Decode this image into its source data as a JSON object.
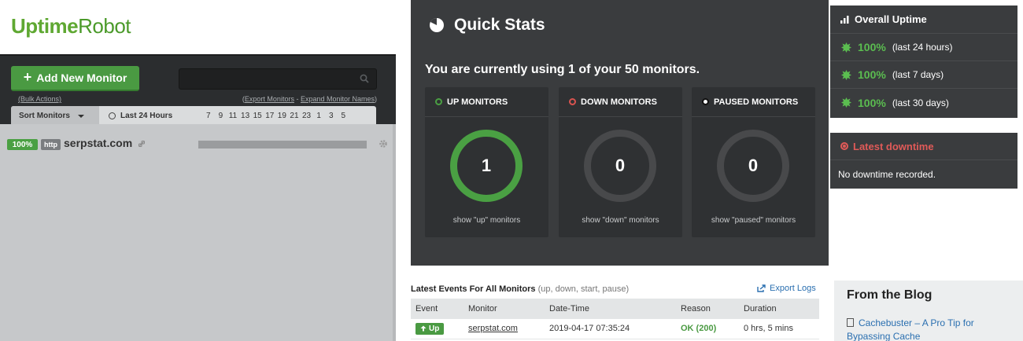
{
  "app": {
    "logo_part1": "Uptime",
    "logo_part2": "Robot"
  },
  "left": {
    "add_monitor_label": "Add New Monitor",
    "bulk_actions": "(Bulk Actions)",
    "export_monitors": "Export Monitors",
    "separator": " - ",
    "expand_names": "Expand Monitor Names",
    "search_placeholder": "",
    "sort_label": "Sort Monitors",
    "last24_label": "Last 24 Hours",
    "hours": [
      "7",
      "9",
      "11",
      "13",
      "15",
      "17",
      "19",
      "21",
      "23",
      "1",
      "3",
      "5"
    ],
    "monitors": [
      {
        "uptime": "100%",
        "type": "http",
        "name": "serpstat.com"
      }
    ]
  },
  "quick_stats": {
    "title": "Quick Stats",
    "usage_text": "You are currently using 1 of your 50 monitors.",
    "boxes": [
      {
        "label": "UP MONITORS",
        "count": "1",
        "footer": "show \"up\" monitors",
        "color": "#4aa043"
      },
      {
        "label": "DOWN MONITORS",
        "count": "0",
        "footer": "show \"down\" monitors",
        "color": "#d9534f"
      },
      {
        "label": "PAUSED MONITORS",
        "count": "0",
        "footer": "show \"paused\" monitors",
        "color": "#111111"
      }
    ]
  },
  "overall_uptime": {
    "title": "Overall Uptime",
    "rows": [
      {
        "pct": "100%",
        "period": "(last 24 hours)"
      },
      {
        "pct": "100%",
        "period": "(last 7 days)"
      },
      {
        "pct": "100%",
        "period": "(last 30 days)"
      }
    ]
  },
  "latest_downtime": {
    "title": "Latest downtime",
    "text": "No downtime recorded."
  },
  "events": {
    "title": "Latest Events For All Monitors",
    "subtitle": "(up, down, start, pause)",
    "export_label": "Export Logs",
    "columns": [
      "Event",
      "Monitor",
      "Date-Time",
      "Reason",
      "Duration"
    ],
    "rows": [
      {
        "event": "Up",
        "monitor": "serpstat.com",
        "datetime": "2019-04-17 07:35:24",
        "reason": "OK (200)",
        "duration": "0 hrs, 5 mins"
      }
    ]
  },
  "blog": {
    "title": "From the Blog",
    "item": "Cachebuster – A Pro Tip for Bypassing Cache"
  },
  "colors": {
    "brand_green": "#4a9a42",
    "down_red": "#d9534f",
    "link_blue": "#2a6fb0"
  }
}
